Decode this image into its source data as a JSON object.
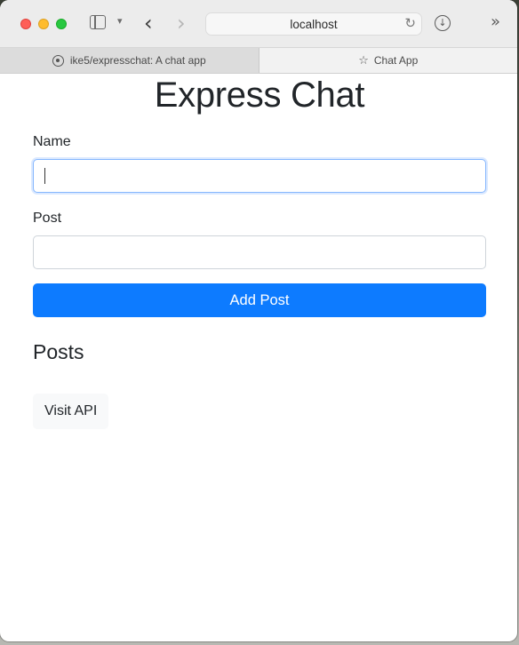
{
  "browser": {
    "address": "localhost",
    "tabs": [
      {
        "label": "ike5/expresschat: A chat app",
        "active": false
      },
      {
        "label": "Chat App",
        "active": true
      }
    ]
  },
  "page": {
    "title": "Express Chat",
    "form": {
      "name_label": "Name",
      "name_value": "",
      "post_label": "Post",
      "post_value": "",
      "submit_label": "Add Post"
    },
    "posts_heading": "Posts",
    "visit_api_label": "Visit API"
  },
  "colors": {
    "primary": "#0d7bff",
    "text": "#212529"
  }
}
